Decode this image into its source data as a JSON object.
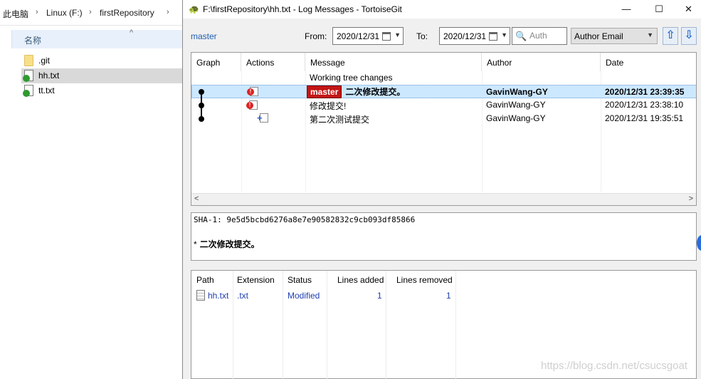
{
  "explorer": {
    "breadcrumb": [
      "此电脑",
      "Linux (F:)",
      "firstRepository"
    ],
    "column_name": "名称",
    "files": [
      {
        "name": ".git",
        "icon": "folder-icon",
        "selected": false
      },
      {
        "name": "hh.txt",
        "icon": "git-file-icon",
        "selected": true
      },
      {
        "name": "tt.txt",
        "icon": "git-file-icon",
        "selected": false
      }
    ]
  },
  "window": {
    "title": "F:\\firstRepository\\hh.txt - Log Messages - TortoiseGit",
    "minimize": "—",
    "maximize": "☐",
    "close": "✕"
  },
  "toolbar": {
    "branch": "master",
    "from_label": "From:",
    "from_date": "2020/12/31",
    "to_label": "To:",
    "to_date": "2020/12/31",
    "search_placeholder": "Auth",
    "filter_field": "Author Email",
    "up_arrow": "⇧",
    "down_arrow": "⇩"
  },
  "log": {
    "headers": {
      "graph": "Graph",
      "actions": "Actions",
      "message": "Message",
      "author": "Author",
      "date": "Date"
    },
    "rows": [
      {
        "message": "Working tree changes",
        "author": "",
        "date": "",
        "selected": false
      },
      {
        "ref": "master",
        "message": "二次修改提交。",
        "author": "GavinWang-GY",
        "date": "2020/12/31 23:39:35",
        "selected": true,
        "action": "modified"
      },
      {
        "message": "修改提交!",
        "author": "GavinWang-GY",
        "date": "2020/12/31 23:38:10",
        "selected": false,
        "action": "modified"
      },
      {
        "message": "第二次测试提交",
        "author": "GavinWang-GY",
        "date": "2020/12/31 19:35:51",
        "selected": false,
        "action": "added"
      }
    ],
    "scroll_left": "<",
    "scroll_right": ">"
  },
  "commit": {
    "sha_line": "SHA-1: 9e5d5bcbd6276a8e7e90582832c9cb093df85866",
    "bullet": "*",
    "subject": "二次修改提交。"
  },
  "files": {
    "headers": {
      "path": "Path",
      "extension": "Extension",
      "status": "Status",
      "added": "Lines added",
      "removed": "Lines removed"
    },
    "rows": [
      {
        "path": "hh.txt",
        "extension": ".txt",
        "status": "Modified",
        "added": "1",
        "removed": "1"
      }
    ]
  },
  "watermark": "https://blog.csdn.net/csucsgoat",
  "colors": {
    "ref_tag": "#c31515",
    "selection": "#cce8ff",
    "link": "#1f5fb0"
  }
}
